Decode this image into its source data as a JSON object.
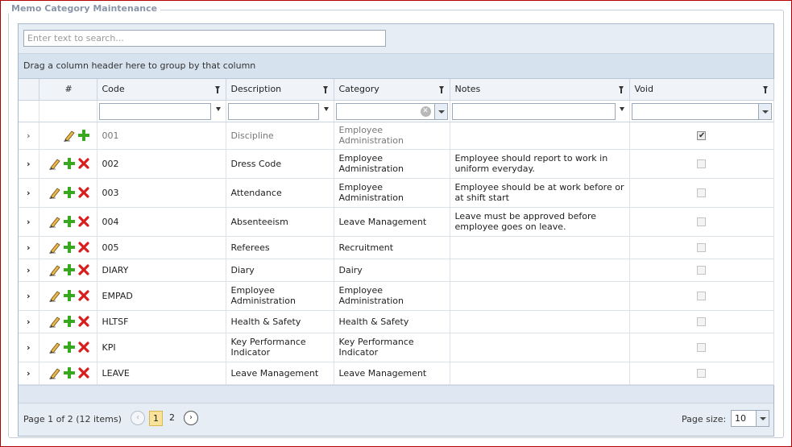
{
  "panel": {
    "title": "Memo Category Maintenance"
  },
  "search": {
    "placeholder": "Enter text to search..."
  },
  "group_panel": {
    "text": "Drag a column header here to group by that column"
  },
  "columns": [
    {
      "label": ""
    },
    {
      "label": "#"
    },
    {
      "label": "Code"
    },
    {
      "label": "Description"
    },
    {
      "label": "Category"
    },
    {
      "label": "Notes"
    },
    {
      "label": "Void"
    }
  ],
  "rows": [
    {
      "code": "001",
      "description": "Discipline",
      "category": "Employee Administration",
      "notes": "",
      "void": true,
      "deletable": false
    },
    {
      "code": "002",
      "description": "Dress Code",
      "category": "Employee Administration",
      "notes": "Employee should report to work in uniform everyday.",
      "void": false,
      "deletable": true
    },
    {
      "code": "003",
      "description": "Attendance",
      "category": "Employee Administration",
      "notes": "Employee should be at work before or at shift start",
      "void": false,
      "deletable": true
    },
    {
      "code": "004",
      "description": "Absenteeism",
      "category": "Leave Management",
      "notes": "Leave must be approved before employee goes on leave.",
      "void": false,
      "deletable": true
    },
    {
      "code": "005",
      "description": "Referees",
      "category": "Recruitment",
      "notes": "",
      "void": false,
      "deletable": true
    },
    {
      "code": "DIARY",
      "description": "Diary",
      "category": "Dairy",
      "notes": "",
      "void": false,
      "deletable": true
    },
    {
      "code": "EMPAD",
      "description": "Employee Administration",
      "category": "Employee Administration",
      "notes": "",
      "void": false,
      "deletable": true
    },
    {
      "code": "HLTSF",
      "description": "Health & Safety",
      "category": "Health & Safety",
      "notes": "",
      "void": false,
      "deletable": true
    },
    {
      "code": "KPI",
      "description": "Key Performance Indicator",
      "category": "Key Performance Indicator",
      "notes": "",
      "void": false,
      "deletable": true
    },
    {
      "code": "LEAVE",
      "description": "Leave Management",
      "category": "Leave Management",
      "notes": "",
      "void": false,
      "deletable": true
    }
  ],
  "pager": {
    "summary": "Page 1 of 2 (12 items)",
    "prev_icon": "chevron-left-icon",
    "next_icon": "chevron-right-icon",
    "pages": [
      "1",
      "2"
    ],
    "current_page": "1",
    "page_size_label": "Page size:",
    "page_size": "10"
  },
  "icons": {
    "expand": "›",
    "edit": "pencil-icon",
    "add": "plus-icon",
    "delete": "delete-x-icon"
  },
  "colors": {
    "frame_border": "#b30000",
    "header_bg": "#f0f4f8",
    "pager_bg": "#e6edf5",
    "active_page": "#f9e39a"
  }
}
